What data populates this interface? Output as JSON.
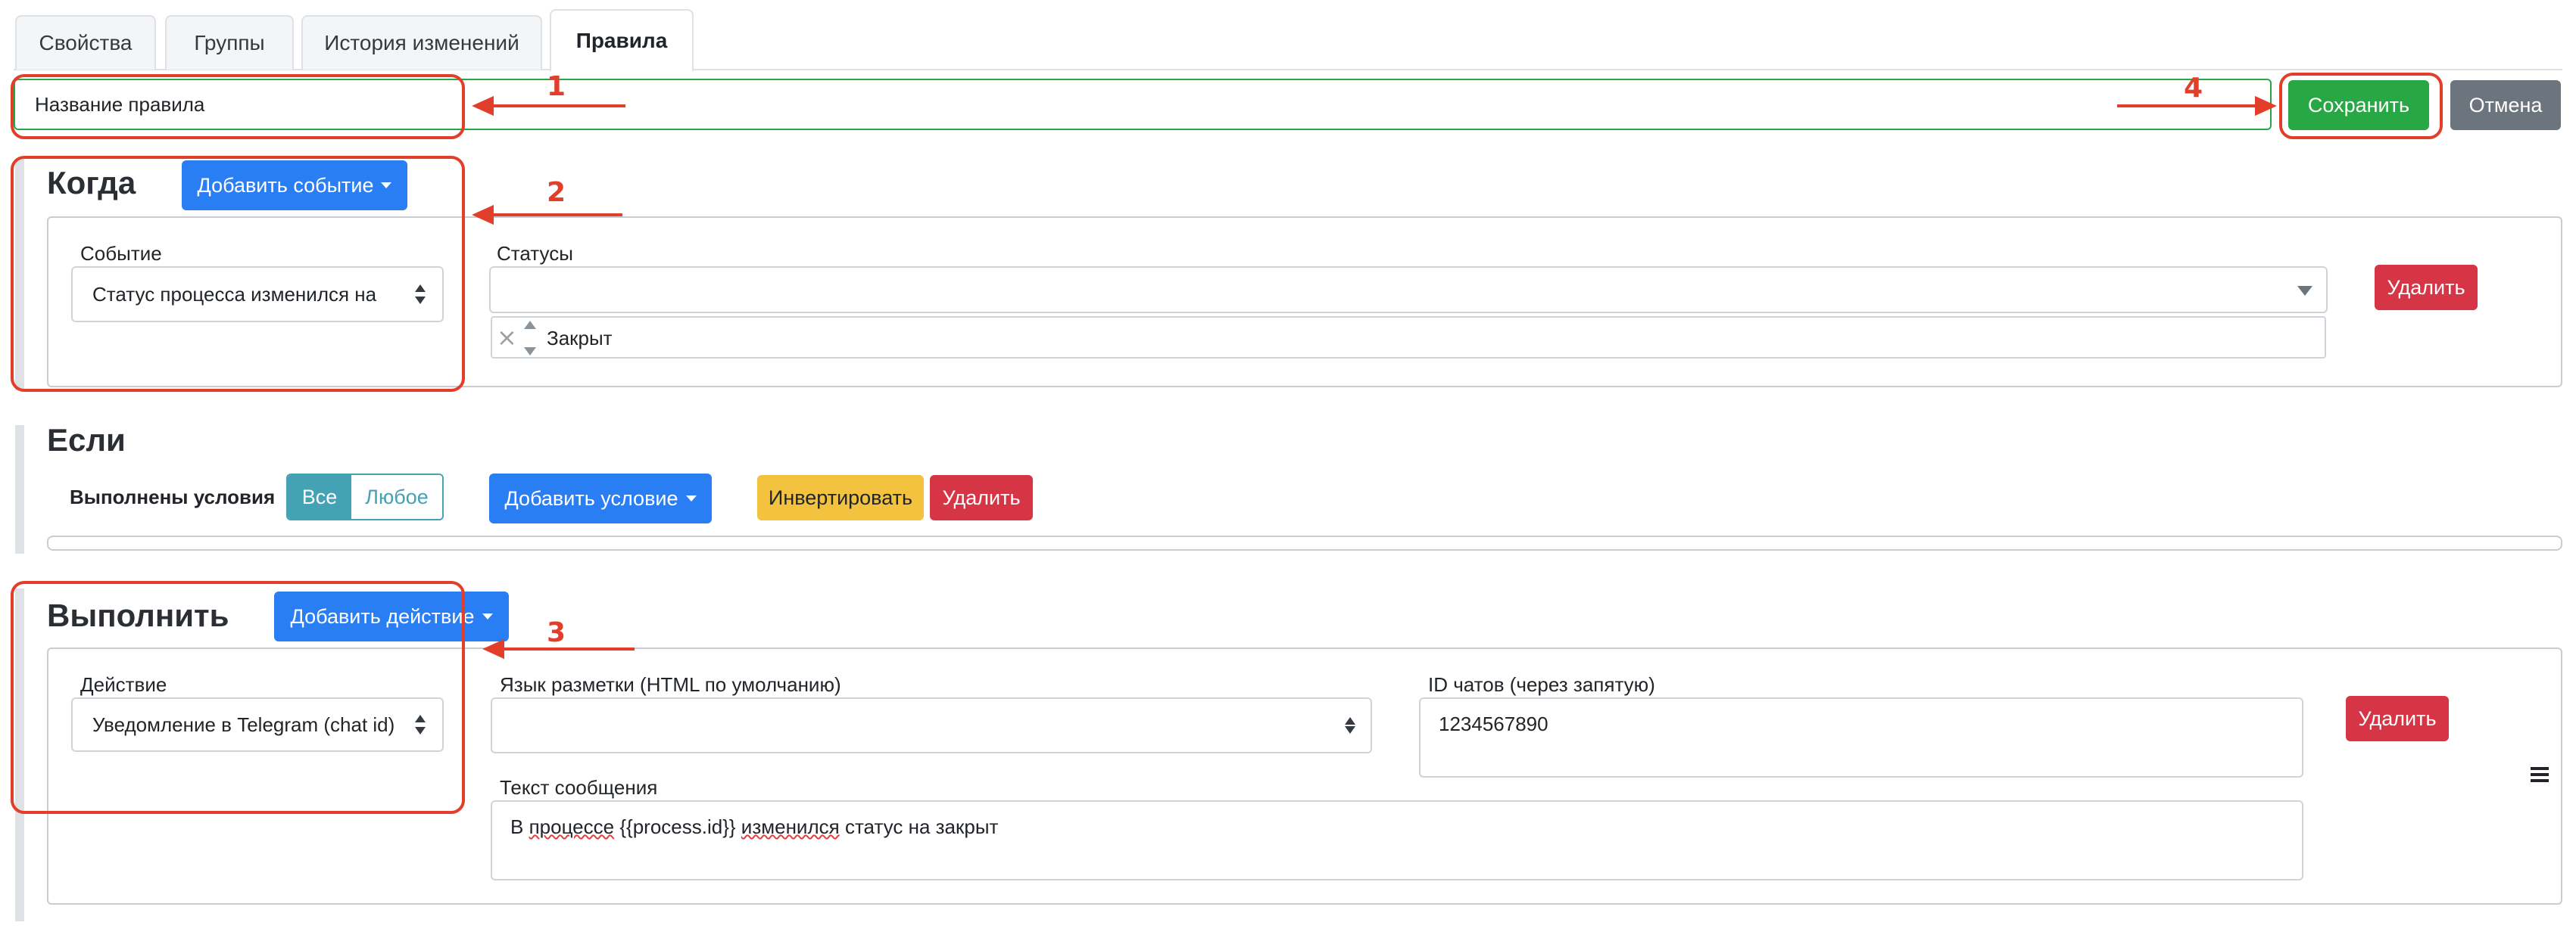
{
  "tabs": [
    {
      "label": "Свойства"
    },
    {
      "label": "Группы"
    },
    {
      "label": "История изменений"
    },
    {
      "label": "Правила"
    }
  ],
  "rule_name": {
    "value": "Название правила"
  },
  "toolbar": {
    "save_label": "Сохранить",
    "cancel_label": "Отмена"
  },
  "when": {
    "title": "Когда",
    "add_event_label": "Добавить событие",
    "event_label": "Событие",
    "event_value": "Статус процесса изменился на",
    "statuses_label": "Статусы",
    "selected_status": "Закрыт",
    "delete_label": "Удалить"
  },
  "if": {
    "title": "Если",
    "conditions_label": "Выполнены условия",
    "all_label": "Все",
    "any_label": "Любое",
    "add_condition_label": "Добавить условие",
    "invert_label": "Инвертировать",
    "delete_label": "Удалить"
  },
  "execute": {
    "title": "Выполнить",
    "add_action_label": "Добавить действие",
    "action_label": "Действие",
    "action_value": "Уведомление в Telegram (chat id)",
    "markup_label": "Язык разметки (HTML по умолчанию)",
    "markup_value": "",
    "chat_ids_label": "ID чатов (через запятую)",
    "chat_ids_value": "1234567890",
    "message_label": "Текст сообщения",
    "message_part1": "В ",
    "message_word1": "процессе",
    "message_part2": " {{process.id}} ",
    "message_word2": "изменился",
    "message_part3": " статус на закрыт",
    "delete_label": "Удалить"
  },
  "annotations": {
    "n1": "1",
    "n2": "2",
    "n3": "3",
    "n4": "4"
  },
  "colors": {
    "accent_red": "#e23e2a",
    "save_green": "#28a745",
    "primary_blue": "#2a7ef4",
    "danger_red": "#d63545",
    "info_teal": "#45a1b4"
  }
}
